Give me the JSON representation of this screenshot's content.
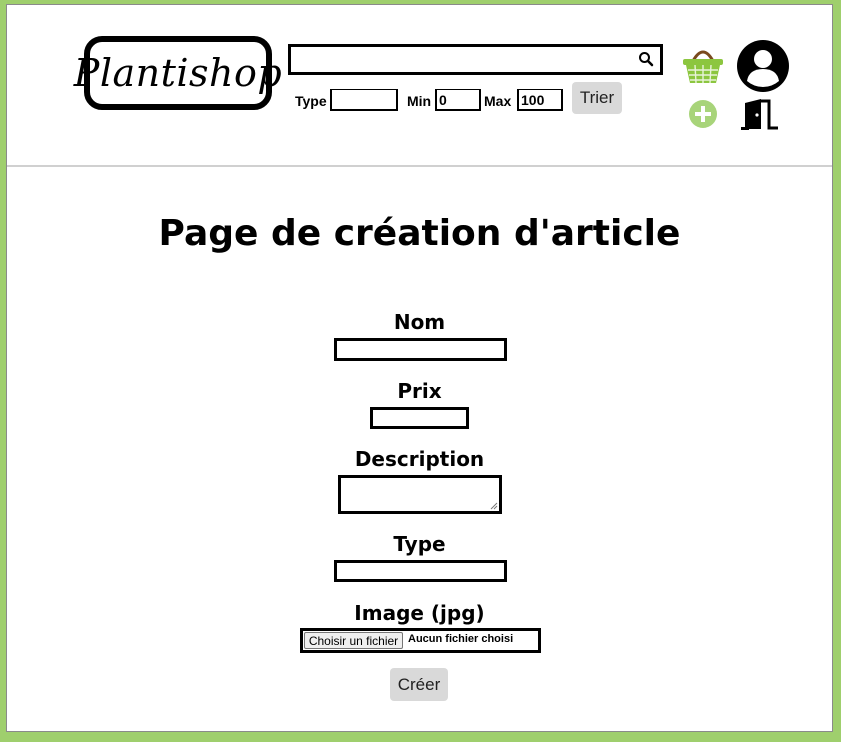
{
  "header": {
    "logo_text": "Plantishop",
    "search": {
      "value": "",
      "placeholder": "",
      "icon": "search-icon"
    },
    "filters": {
      "type_label": "Type",
      "type_value": "",
      "min_label": "Min",
      "min_value": "0",
      "max_label": "Max",
      "max_value": "100",
      "sort_button": "Trier"
    },
    "icons": [
      "basket-icon",
      "account-icon",
      "add-icon",
      "logout-door-icon"
    ]
  },
  "main": {
    "title": "Page de création d'article",
    "form": {
      "name_label": "Nom",
      "price_label": "Prix",
      "description_label": "Description",
      "type_label": "Type",
      "image_label": "Image (jpg)",
      "file_button": "Choisir un fichier",
      "file_status": "Aucun fichier choisi",
      "submit_button": "Créer"
    }
  },
  "colors": {
    "background": "#9fcf6d",
    "accent_green": "#8cc63f",
    "button_gray": "#d9d9d9"
  }
}
